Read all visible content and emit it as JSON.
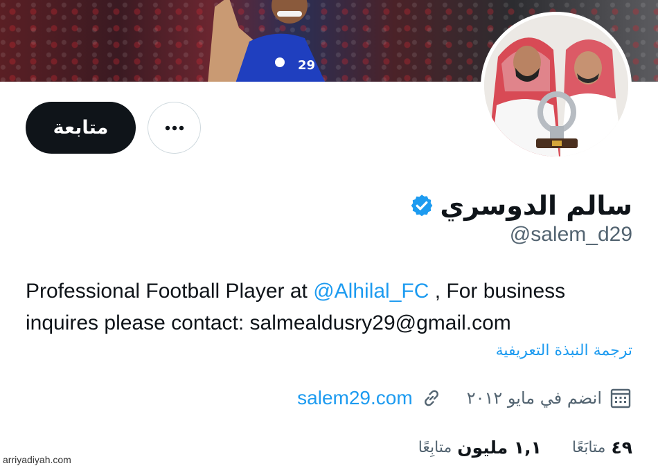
{
  "profile": {
    "name": "سالم الدوسري",
    "handle": "@salem_d29",
    "bio_prefix": "Professional Football Player at ",
    "bio_mention": "@Alhilal_FC",
    "bio_suffix": " , For business inquires please contact: salmealdusry29@gmail.com",
    "translate_label": "ترجمة النبذة التعريفية",
    "joined": "انضم في مايو ٢٠١٢",
    "website": "salem29.com"
  },
  "actions": {
    "follow_label": "متابعة"
  },
  "stats": {
    "following_count": "٤٩",
    "following_label": "متابَعًا",
    "followers_count": "١,١ مليون",
    "followers_label": "متابِعًا"
  },
  "watermark": "arriyadiyah.com",
  "colors": {
    "accent": "#1d9bf0",
    "text": "#0f1419",
    "muted": "#536471",
    "button": "#0f1419"
  },
  "icons": {
    "more": "more-icon",
    "verified": "verified-badge-icon",
    "calendar": "calendar-icon",
    "link": "link-icon"
  }
}
